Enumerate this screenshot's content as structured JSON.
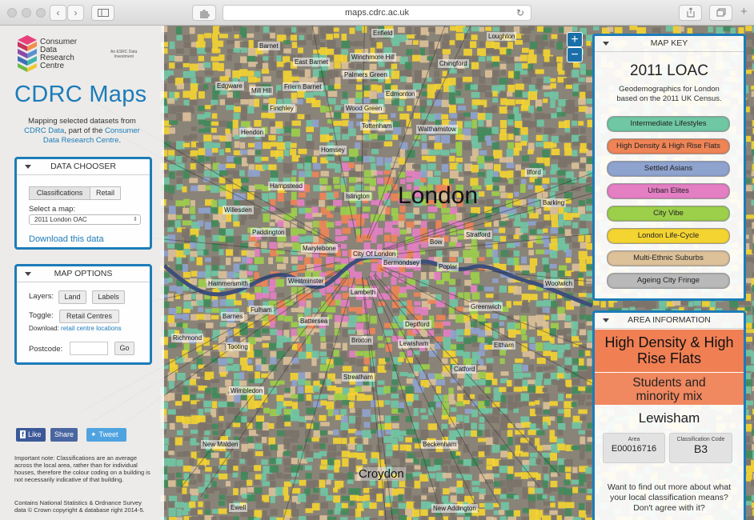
{
  "browser": {
    "url": "maps.cdrc.ac.uk",
    "back_icon": "‹",
    "forward_icon": "›"
  },
  "left_panel": {
    "logo_lines": [
      "Consumer",
      "Data",
      "Research",
      "Centre"
    ],
    "esrc_text": [
      "An ESRC Data",
      "Investment"
    ],
    "app_title": "CDRC Maps",
    "intro_prefix": "Mapping selected datasets from",
    "intro_link1": "CDRC Data",
    "intro_mid": ", part of the",
    "intro_link2": "Consumer Data Research Centre",
    "intro_suffix": "."
  },
  "data_chooser": {
    "header": "DATA CHOOSER",
    "tabs": [
      "Classifications",
      "Retail"
    ],
    "select_label": "Select a map:",
    "select_value": "2011 London OAC",
    "download_link": "Download this data"
  },
  "map_options": {
    "header": "MAP OPTIONS",
    "layers_label": "Layers:",
    "layer_buttons": [
      "Land",
      "Labels"
    ],
    "toggle_label": "Toggle:",
    "toggle_button": "Retail Centres",
    "download_prefix": "Download:",
    "download_link": "retail centre locations",
    "postcode_label": "Postcode:",
    "postcode_placeholder": "",
    "go_button": "Go"
  },
  "social": {
    "like": "Like",
    "share": "Share",
    "tweet": "Tweet"
  },
  "notes": {
    "important": "Important note: Classifications are an average across the local area, rather than for individual houses, therefore the colour coding on a building is not necessarily indicative of that building.",
    "copyright": "Contains National Statistics & Ordnance Survey data © Crown copyright & database right 2014-5."
  },
  "map": {
    "big_label": "London",
    "croydon": "Croydon",
    "zoom_in": "+",
    "zoom_out": "−",
    "places": [
      "Enfield",
      "Barnet",
      "East Barnet",
      "Winchmore Hill",
      "Palmers Green",
      "Chingford",
      "Edgware",
      "Mill Hill",
      "Friern Barnet",
      "Edmonton",
      "Finchley",
      "Wood Green",
      "Tottenham",
      "Walthamstow",
      "Hendon",
      "Hornsey",
      "Ilford",
      "Hampstead",
      "Islington",
      "Willesden",
      "Barking",
      "Paddington",
      "Stratford",
      "Marylebone",
      "Bow",
      "City Of London",
      "Poplar",
      "Hammersmith",
      "Westminster",
      "Bermondsey",
      "Woolwich",
      "Lambeth",
      "Greenwich",
      "Fulham",
      "Battersea",
      "Barnes",
      "Deptford",
      "Richmond",
      "Brixton",
      "Lewisham",
      "Eltham",
      "Tooting",
      "Streatham",
      "Catford",
      "Wimbledon",
      "Beckenham",
      "New Malden",
      "Ewell",
      "New Addington",
      "Loughton"
    ]
  },
  "map_key": {
    "header": "MAP KEY",
    "title": "2011 LOAC",
    "subtitle": "Geodemographics for London based on the 2011 UK Census.",
    "items": [
      {
        "label": "Intermediate Lifestyles",
        "color": "#6fc7a4"
      },
      {
        "label": "High Density & High Rise Flats",
        "color": "#ef8456"
      },
      {
        "label": "Settled Asians",
        "color": "#8fa3cf"
      },
      {
        "label": "Urban Elites",
        "color": "#e47fc4"
      },
      {
        "label": "City Vibe",
        "color": "#9ccf4a"
      },
      {
        "label": "London Life-Cycle",
        "color": "#f4d431"
      },
      {
        "label": "Multi-Ethnic Suburbs",
        "color": "#dcc199"
      },
      {
        "label": "Ageing City Fringe",
        "color": "#b9b9b9"
      }
    ]
  },
  "area_info": {
    "header": "AREA INFORMATION",
    "class_name": "High Density & High Rise Flats",
    "subgroup": "Students and minority mix",
    "borough": "Lewisham",
    "area_label": "Area",
    "area_value": "E00016716",
    "code_label": "Classification Code",
    "code_value": "B3",
    "footer": "Want to find out more about what your local classification means? Don't agree with it?"
  }
}
